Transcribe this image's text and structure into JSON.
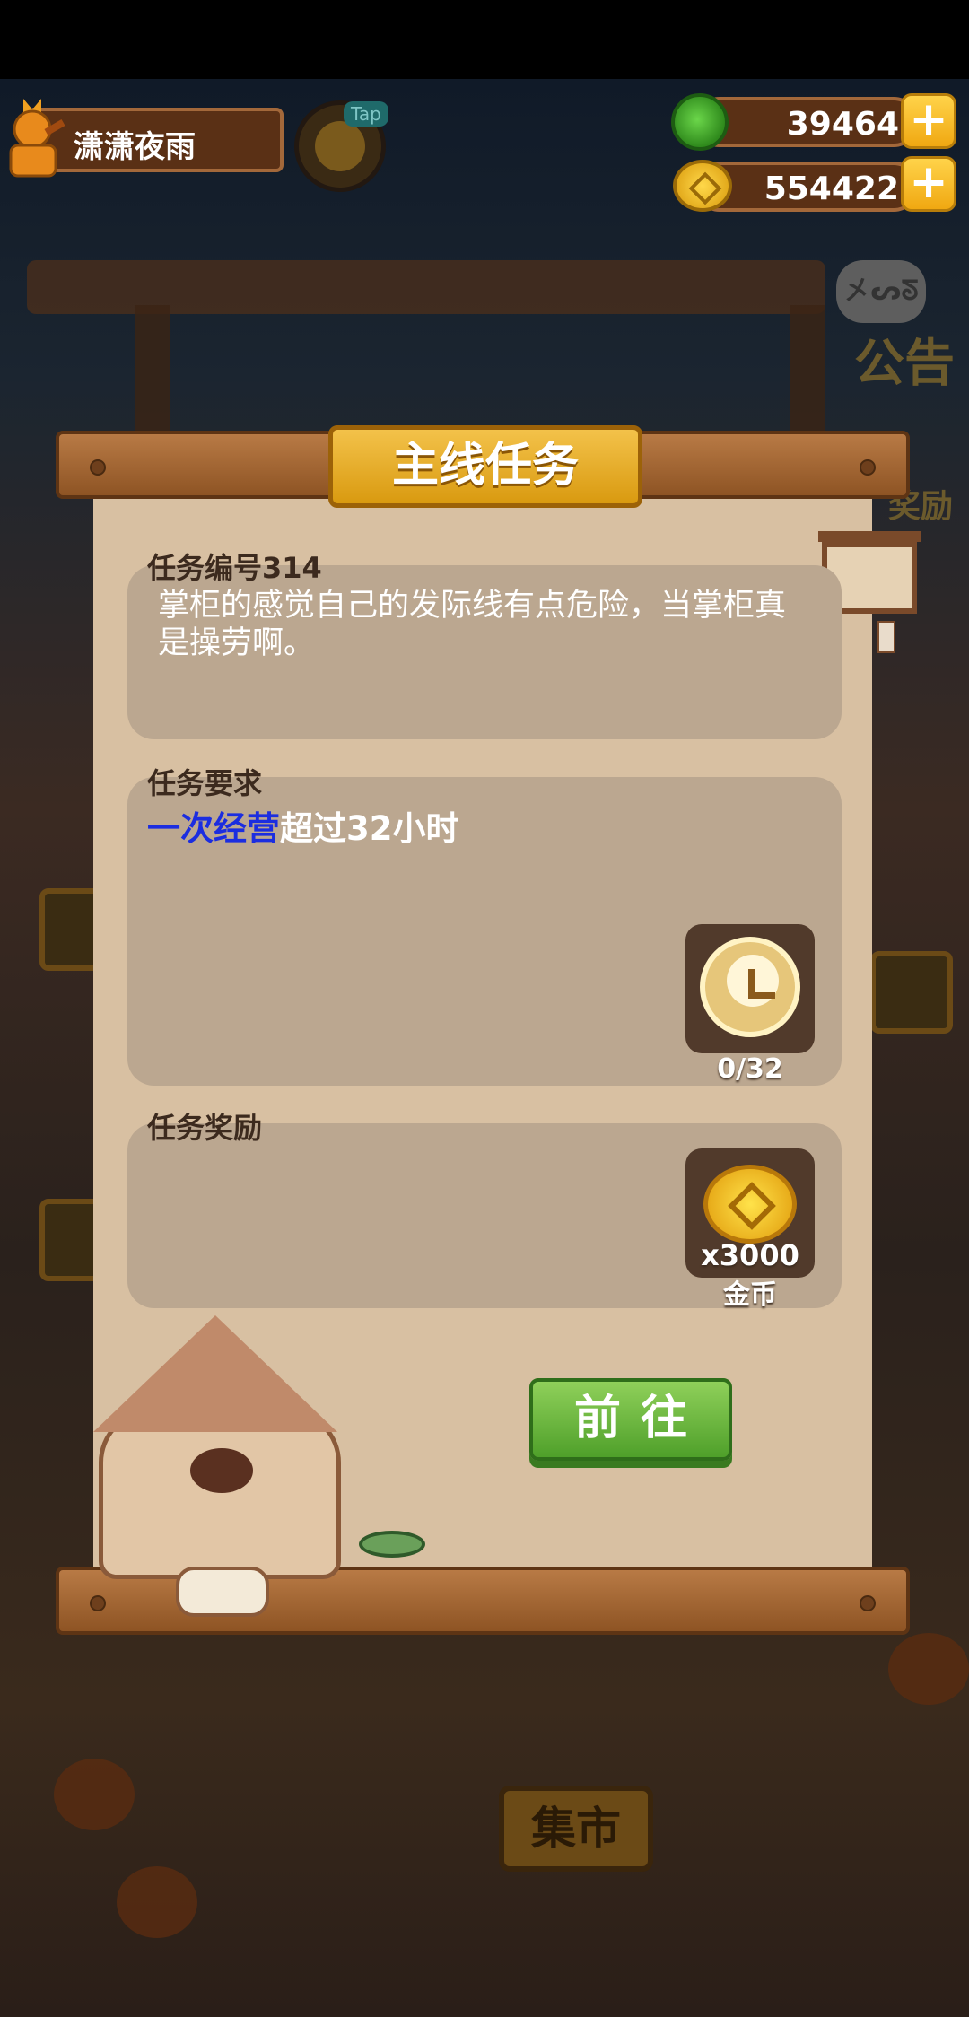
{
  "hud": {
    "player_name": "潇潇夜雨",
    "tap_label": "Tap",
    "gems": "39464",
    "coins": "554422",
    "plus_symbol": "+"
  },
  "background": {
    "notice_bubble": "㐅ᔕᘕ",
    "notice_label": "公告",
    "reward_tag": "奖励",
    "market_sign": "集市"
  },
  "dialog": {
    "title": "主线任务",
    "task_number_label": "任务编号314",
    "task_description": "掌柜的感觉自己的发际线有点危险，当掌柜真是操劳啊。",
    "requirement_label": "任务要求",
    "requirement_highlight": "一次经营",
    "requirement_rest": "超过32小时",
    "progress_text": "0/32",
    "reward_label": "任务奖励",
    "reward_amount": "x3000",
    "reward_name": "金币",
    "go_button": "前往"
  },
  "colors": {
    "highlight": "#1b2de0",
    "paper": "#d8c0a2",
    "button_green": "#4fa02a",
    "title_gold": "#f3c24a"
  }
}
